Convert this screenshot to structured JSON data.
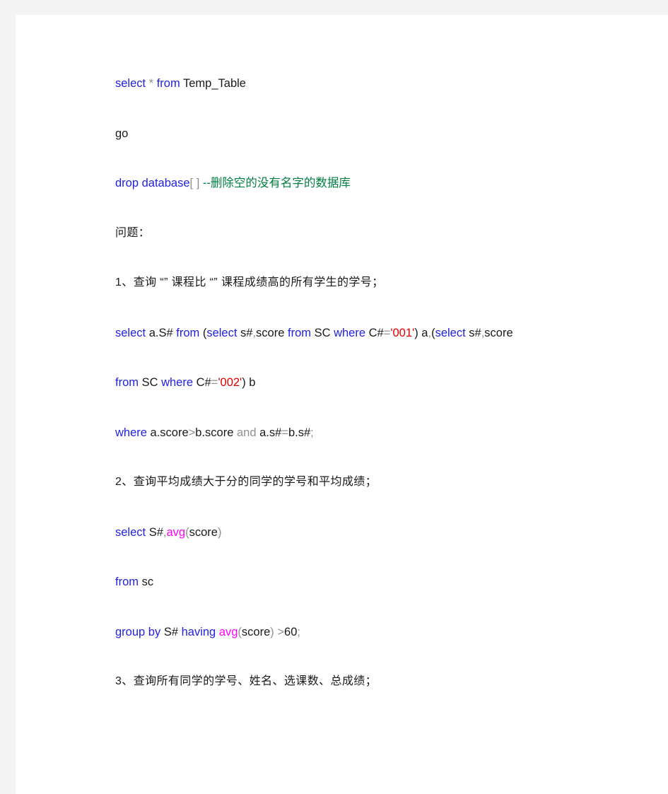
{
  "document": {
    "page_background": "#ffffff",
    "canvas_background": "#f4f4f4",
    "syntax_colors": {
      "keyword": "#2222dd",
      "function": "#ff00ff",
      "string": "#e00000",
      "comment": "#008040",
      "operator": "#909090",
      "identifier": "#1a1a1a"
    },
    "lines": [
      {
        "id": "line-1",
        "kind": "sql",
        "text": "select * from Temp_Table",
        "tokens": [
          {
            "t": "select",
            "c": "kw"
          },
          {
            "t": " ",
            "c": "id"
          },
          {
            "t": "*",
            "c": "op"
          },
          {
            "t": " ",
            "c": "id"
          },
          {
            "t": "from",
            "c": "kw"
          },
          {
            "t": " Temp_Table",
            "c": "id"
          }
        ]
      },
      {
        "id": "line-2",
        "kind": "sql",
        "text": "go",
        "tokens": [
          {
            "t": "go",
            "c": "id"
          }
        ]
      },
      {
        "id": "line-3",
        "kind": "sql",
        "text": "drop database[ ]   --删除空的没有名字的数据库",
        "tokens": [
          {
            "t": "drop",
            "c": "kw"
          },
          {
            "t": "  ",
            "c": "id"
          },
          {
            "t": "database",
            "c": "kw"
          },
          {
            "t": "[ ]",
            "c": "op"
          },
          {
            "t": "   ",
            "c": "id"
          },
          {
            "t": "--删除空的没有名字的数据库",
            "c": "cmt"
          }
        ]
      },
      {
        "id": "line-4",
        "kind": "cn",
        "text": "问题：",
        "tokens": [
          {
            "t": "问题：",
            "c": "id"
          }
        ]
      },
      {
        "id": "line-5",
        "kind": "cn",
        "text": "1、查询“”课程比“”课程成绩高的所有学生的学号；",
        "tokens": [
          {
            "t": "1、查询 “” 课程比 “” 课程成绩高的所有学生的学号；",
            "c": "id"
          }
        ]
      },
      {
        "id": "line-6",
        "kind": "sql",
        "text": "select a.S# from (select s#,score from SC where C#='001') a,(select s#,score",
        "tokens": [
          {
            "t": "select",
            "c": "kw"
          },
          {
            "t": " a.S# ",
            "c": "id"
          },
          {
            "t": "from",
            "c": "kw"
          },
          {
            "t": " (",
            "c": "id"
          },
          {
            "t": "select",
            "c": "kw"
          },
          {
            "t": " s#",
            "c": "id"
          },
          {
            "t": ",",
            "c": "op"
          },
          {
            "t": "score ",
            "c": "id"
          },
          {
            "t": "from",
            "c": "kw"
          },
          {
            "t": " SC ",
            "c": "id"
          },
          {
            "t": "where",
            "c": "kw"
          },
          {
            "t": " C#",
            "c": "id"
          },
          {
            "t": "=",
            "c": "op"
          },
          {
            "t": "'001'",
            "c": "str"
          },
          {
            "t": ") a",
            "c": "id"
          },
          {
            "t": ",",
            "c": "op"
          },
          {
            "t": "(",
            "c": "id"
          },
          {
            "t": "select",
            "c": "kw"
          },
          {
            "t": " s#",
            "c": "id"
          },
          {
            "t": ",",
            "c": "op"
          },
          {
            "t": "score",
            "c": "id"
          }
        ]
      },
      {
        "id": "line-7",
        "kind": "sql",
        "text": "from SC where C#='002') b",
        "tokens": [
          {
            "t": "from",
            "c": "kw"
          },
          {
            "t": " SC ",
            "c": "id"
          },
          {
            "t": "where",
            "c": "kw"
          },
          {
            "t": " C#",
            "c": "id"
          },
          {
            "t": "=",
            "c": "op"
          },
          {
            "t": "'002'",
            "c": "str"
          },
          {
            "t": ") b",
            "c": "id"
          }
        ]
      },
      {
        "id": "line-8",
        "kind": "sql",
        "text": "where a.score>b.score and a.s#=b.s#;",
        "tokens": [
          {
            "t": "where",
            "c": "kw"
          },
          {
            "t": " a.score",
            "c": "id"
          },
          {
            "t": ">",
            "c": "op"
          },
          {
            "t": "b.score ",
            "c": "id"
          },
          {
            "t": "and",
            "c": "op"
          },
          {
            "t": " a.s#",
            "c": "id"
          },
          {
            "t": "=",
            "c": "op"
          },
          {
            "t": "b.s#",
            "c": "id"
          },
          {
            "t": ";",
            "c": "op"
          }
        ]
      },
      {
        "id": "line-9",
        "kind": "cn",
        "text": "2、查询平均成绩大于分的同学的学号和平均成绩；",
        "tokens": [
          {
            "t": "2、查询平均成绩大于分的同学的学号和平均成绩；",
            "c": "id"
          }
        ]
      },
      {
        "id": "line-10",
        "kind": "sql",
        "text": "select S#,avg(score)",
        "tokens": [
          {
            "t": "select",
            "c": "kw"
          },
          {
            "t": " S#",
            "c": "id"
          },
          {
            "t": ",",
            "c": "op"
          },
          {
            "t": "avg",
            "c": "fn"
          },
          {
            "t": "(",
            "c": "op"
          },
          {
            "t": "score",
            "c": "id"
          },
          {
            "t": ")",
            "c": "op"
          }
        ]
      },
      {
        "id": "line-11",
        "kind": "sql",
        "text": "from sc",
        "tokens": [
          {
            "t": "from",
            "c": "kw"
          },
          {
            "t": " sc",
            "c": "id"
          }
        ]
      },
      {
        "id": "line-12",
        "kind": "sql",
        "text": "group by S# having avg(score) >60;",
        "tokens": [
          {
            "t": "group",
            "c": "kw"
          },
          {
            "t": "  ",
            "c": "id"
          },
          {
            "t": "by",
            "c": "kw"
          },
          {
            "t": " S# ",
            "c": "id"
          },
          {
            "t": "having",
            "c": "kw"
          },
          {
            "t": " ",
            "c": "id"
          },
          {
            "t": "avg",
            "c": "fn"
          },
          {
            "t": "(",
            "c": "op"
          },
          {
            "t": "score",
            "c": "id"
          },
          {
            "t": ")",
            "c": "op"
          },
          {
            "t": "  ",
            "c": "id"
          },
          {
            "t": ">",
            "c": "op"
          },
          {
            "t": "60",
            "c": "id"
          },
          {
            "t": ";",
            "c": "op"
          }
        ]
      },
      {
        "id": "line-13",
        "kind": "cn",
        "text": "3、查询所有同学的学号、姓名、选课数、总成绩；",
        "tokens": [
          {
            "t": "3、查询所有同学的学号、姓名、选课数、总成绩；",
            "c": "id"
          }
        ]
      }
    ]
  }
}
